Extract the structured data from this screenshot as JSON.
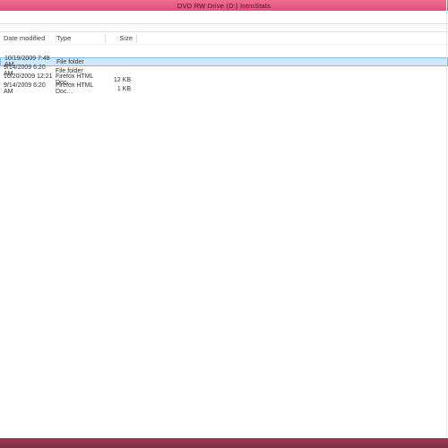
{
  "title": "DVD RW Drive (D:) IntroStats",
  "columns": {
    "date": "Date modified",
    "type": "Type",
    "size": "Size"
  },
  "rows": [
    {
      "date": "10/19/2009 7:48 AM",
      "type": "File folder",
      "size": "",
      "selected": true
    },
    {
      "date": "9/14/2009 6:20 AM",
      "type": "File folder",
      "size": "",
      "selected": false
    },
    {
      "date": "10/20/2009 12:21 …",
      "type": "Firefox HTML Doc…",
      "size": "12 KB",
      "selected": false
    },
    {
      "date": "9/14/2009 6:20 AM",
      "type": "Firefox HTML Doc…",
      "size": "1 KB",
      "selected": false
    }
  ]
}
